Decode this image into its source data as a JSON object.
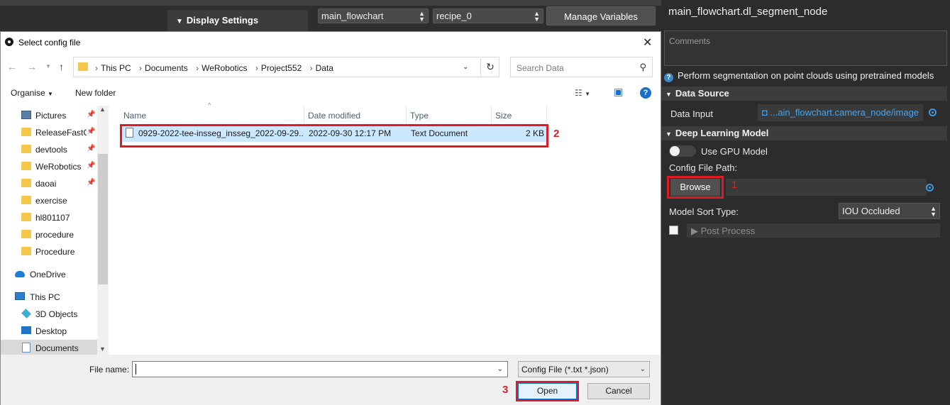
{
  "app": {
    "display_settings": "Display Settings",
    "flowchart_select": "main_flowchart",
    "recipe_select": "recipe_0",
    "manage_variables": "Manage Variables"
  },
  "panel": {
    "node_title": "main_flowchart.dl_segment_node",
    "comments_placeholder": "Comments",
    "description": "Perform segmentation on point clouds using pretrained models",
    "data_source": {
      "section": "Data Source",
      "data_input_label": "Data Input",
      "data_input_value": "...ain_flowchart.camera_node/image"
    },
    "dl_model": {
      "section": "Deep Learning Model",
      "use_gpu_label": "Use GPU Model",
      "config_path_label": "Config File Path:",
      "browse_label": "Browse",
      "model_sort_label": "Model Sort Type:",
      "model_sort_value": "IOU Occluded",
      "post_process_label": "Post Process"
    }
  },
  "dialog": {
    "title": "Select config file",
    "breadcrumb": [
      "This PC",
      "Documents",
      "WeRobotics",
      "Project552",
      "Data"
    ],
    "search_placeholder": "Search Data",
    "toolbar": {
      "organise": "Organise",
      "new_folder": "New folder"
    },
    "sidebar": [
      {
        "label": "Pictures",
        "icon": "pictures-icon",
        "pinned": true
      },
      {
        "label": "ReleaseFastCr",
        "icon": "folder-icon",
        "pinned": true
      },
      {
        "label": "devtools",
        "icon": "folder-icon",
        "pinned": true
      },
      {
        "label": "WeRobotics",
        "icon": "folder-icon",
        "pinned": true
      },
      {
        "label": "daoai",
        "icon": "folder-icon",
        "pinned": true
      },
      {
        "label": "exercise",
        "icon": "folder-icon",
        "pinned": false
      },
      {
        "label": "hl801107",
        "icon": "folder-icon",
        "pinned": false
      },
      {
        "label": "procedure",
        "icon": "folder-icon",
        "pinned": false
      },
      {
        "label": "Procedure",
        "icon": "folder-icon",
        "pinned": false
      },
      {
        "label": "OneDrive",
        "icon": "cloud-icon",
        "pinned": false
      },
      {
        "label": "This PC",
        "icon": "pc-icon",
        "pinned": false
      },
      {
        "label": "3D Objects",
        "icon": "cube-icon",
        "pinned": false
      },
      {
        "label": "Desktop",
        "icon": "desktop-icon",
        "pinned": false
      },
      {
        "label": "Documents",
        "icon": "documents-icon",
        "pinned": false,
        "selected": true
      }
    ],
    "columns": [
      "Name",
      "Date modified",
      "Type",
      "Size"
    ],
    "files": [
      {
        "name": "0929-2022-tee-insseg_insseg_2022-09-29...",
        "date": "2022-09-30 12:17 PM",
        "type": "Text Document",
        "size": "2 KB"
      }
    ],
    "file_name_label": "File name:",
    "file_name_value": "",
    "file_type": "Config File (*.txt *.json)",
    "open_label": "Open",
    "cancel_label": "Cancel"
  },
  "annotations": [
    "1",
    "2",
    "3"
  ],
  "colors": {
    "annotation": "#e01b24",
    "accent": "#0078d7",
    "link": "#4aa3e8"
  }
}
